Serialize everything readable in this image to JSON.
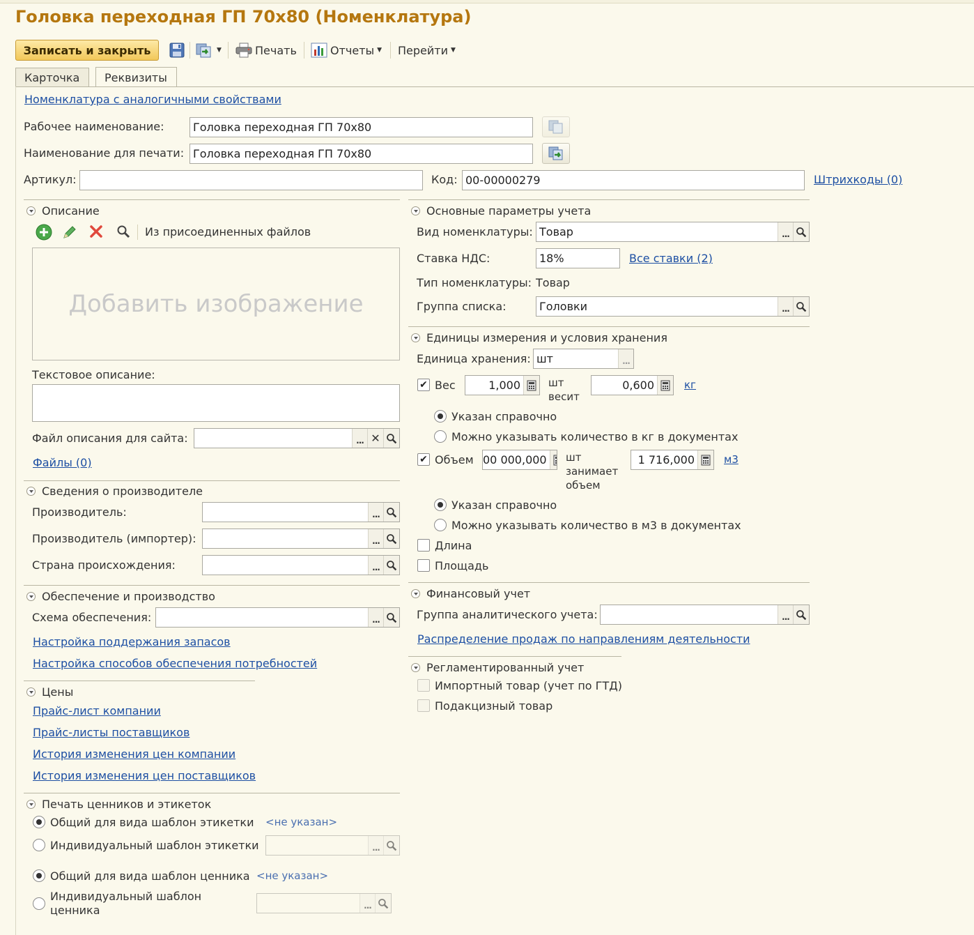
{
  "window": {
    "title": "Головка переходная ГП 70x80 (Номенклатура)"
  },
  "toolbar": {
    "save_close": "Записать и закрыть",
    "print": "Печать",
    "reports": "Отчеты",
    "goto": "Перейти"
  },
  "tabs": [
    "Карточка",
    "Реквизиты"
  ],
  "top": {
    "similar_link": "Номенклатура с аналогичными свойствами",
    "work_name_label": "Рабочее наименование:",
    "work_name_value": "Головка переходная ГП 70x80",
    "print_name_label": "Наименование для печати:",
    "print_name_value": "Головка переходная ГП 70x80",
    "article_label": "Артикул:",
    "article_value": "",
    "code_label": "Код:",
    "code_value": "00-00000279",
    "barcodes_link": "Штрихкоды (0)"
  },
  "description": {
    "header": "Описание",
    "from_files": "Из присоединенных файлов",
    "add_image": "Добавить изображение",
    "text_label": "Текстовое описание:",
    "site_file_label": "Файл описания для сайта:",
    "files_link": "Файлы (0)"
  },
  "manufacturer": {
    "header": "Сведения о производителе",
    "maker_label": "Производитель:",
    "importer_label": "Производитель (импортер):",
    "country_label": "Страна происхождения:"
  },
  "supply": {
    "header": "Обеспечение и производство",
    "scheme_label": "Схема обеспечения:",
    "stock_link": "Настройка поддержания запасов",
    "methods_link": "Настройка способов обеспечения потребностей"
  },
  "prices": {
    "header": "Цены",
    "links": [
      "Прайс-лист компании",
      "Прайс-листы поставщиков",
      "История изменения цен компании",
      "История изменения цен поставщиков"
    ]
  },
  "labels_print": {
    "header": "Печать ценников и этикеток",
    "common_label": "Общий для вида шаблон этикетки",
    "common_label_value": "<не указан>",
    "individual_label": "Индивидуальный шаблон этикетки",
    "common_tag": "Общий для вида шаблон ценника",
    "common_tag_value": "<не указан>",
    "individual_tag_1": "Индивидуальный шаблон",
    "individual_tag_2": "ценника"
  },
  "accounting": {
    "header": "Основные параметры учета",
    "kind_label": "Вид номенклатуры:",
    "kind_value": "Товар",
    "vat_label": "Ставка НДС:",
    "vat_value": "18%",
    "all_rates_link": "Все ставки (2)",
    "type_label": "Тип номенклатуры:",
    "type_value": "Товар",
    "group_label": "Группа списка:",
    "group_value": "Головки"
  },
  "units": {
    "header": "Единицы измерения и условия хранения",
    "storage_label": "Единица хранения:",
    "storage_value": "шт",
    "weight_label": "Вес",
    "weight_qty": "1,000",
    "weight_unit": "шт",
    "weight_verb": "весит",
    "weight_value": "0,600",
    "weight_measure": "кг",
    "weight_opt1": "Указан справочно",
    "weight_opt2": "Можно указывать количество в кг в документах",
    "volume_label": "Объем",
    "volume_qty": "00 000,000",
    "volume_unit": "шт",
    "volume_verb1": "занимает",
    "volume_verb2": "объем",
    "volume_value": "1 716,000",
    "volume_measure": "м3",
    "volume_opt1": "Указан справочно",
    "volume_opt2": "Можно указывать количество в м3 в документах",
    "length_label": "Длина",
    "area_label": "Площадь"
  },
  "finance": {
    "header": "Финансовый учет",
    "group_label": "Группа аналитического учета:",
    "distribution_link": "Распределение продаж по направлениям деятельности"
  },
  "regulated": {
    "header": "Регламентированный учет",
    "import_label": "Импортный товар (учет по ГТД)",
    "excise_label": "Подакцизный товар"
  }
}
